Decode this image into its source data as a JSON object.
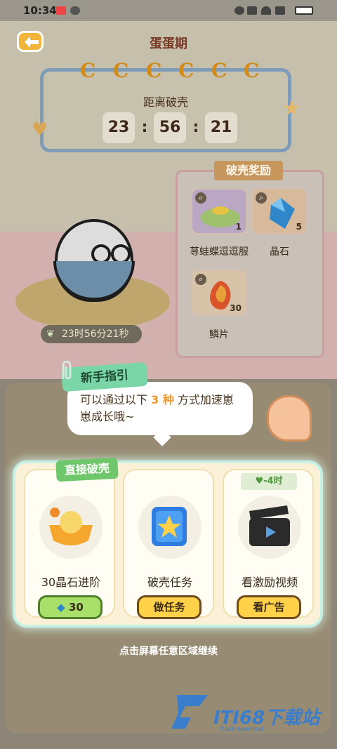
{
  "status_bar": {
    "time": "10:34"
  },
  "header": {
    "title": "蛋蛋期"
  },
  "timer": {
    "c_marks": [
      "C",
      "C",
      "C",
      "C",
      "C",
      "C"
    ],
    "label": "距离破壳",
    "hours": "23",
    "minutes": "56",
    "seconds": "21",
    "separator": ":"
  },
  "rewards": {
    "title": "破壳奖励",
    "items": [
      {
        "name": "荨蛙蝶逗逗服",
        "count": "1"
      },
      {
        "name": "晶石",
        "count": "5"
      },
      {
        "name": "鳞片",
        "count": "30"
      }
    ]
  },
  "egg_status": {
    "remaining_time": "23时56分21秒"
  },
  "guide": {
    "tag": "新手指引",
    "text_before": "可以通过以下",
    "highlight": "3 种",
    "text_after": "方式加速崽崽成长哦~"
  },
  "options": {
    "direct_tag": "直接破壳",
    "cooldown_tag": "-4时",
    "items": [
      {
        "label": "30晶石进阶",
        "button": "30"
      },
      {
        "label": "破壳任务",
        "button": "做任务"
      },
      {
        "label": "看激励视频",
        "button": "看广告"
      }
    ]
  },
  "footer": {
    "continue_text": "点击屏幕任意区域继续"
  },
  "watermark": {
    "text": "ITI68下载站",
    "sub": "iT168 download"
  },
  "colors": {
    "accent": "#f09a2b",
    "green_button": "#a8e06a",
    "yellow_button": "#ffd24a"
  }
}
